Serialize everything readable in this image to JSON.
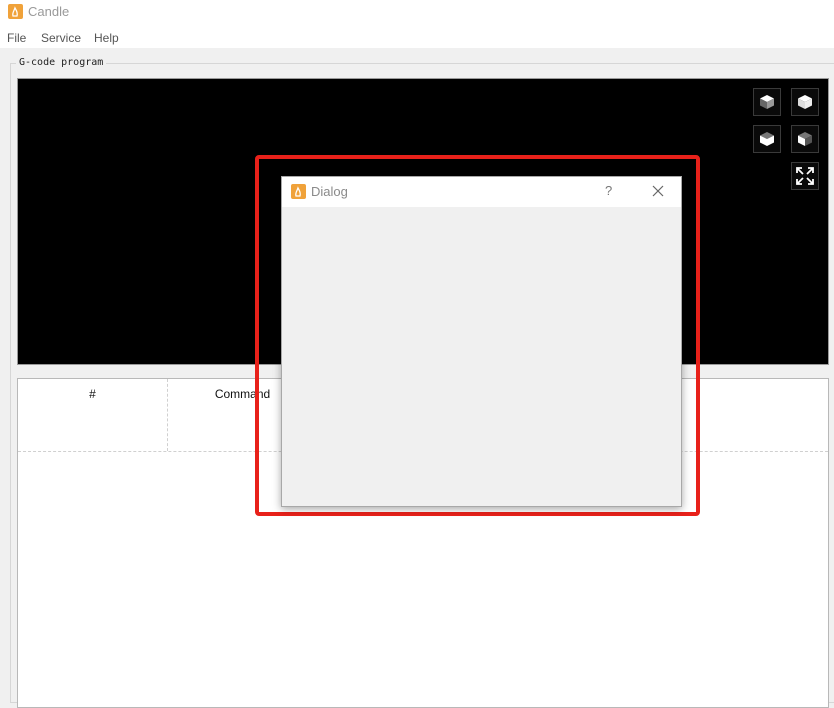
{
  "app": {
    "title": "Candle"
  },
  "menu": [
    "File",
    "Service",
    "Help"
  ],
  "group": {
    "title": "G-code program"
  },
  "viewer": {
    "buttons": [
      {
        "name": "view-isometric-button",
        "icon": "cube-iso-icon"
      },
      {
        "name": "view-top-button",
        "icon": "cube-top-icon"
      },
      {
        "name": "view-front-button",
        "icon": "cube-front-icon"
      },
      {
        "name": "view-left-button",
        "icon": "cube-left-icon"
      },
      {
        "name": "fit-view-button",
        "icon": "expand-icon"
      }
    ]
  },
  "table": {
    "columns": [
      "#",
      "Command"
    ]
  },
  "dialog": {
    "title": "Dialog",
    "help": "?",
    "close_icon": "close-icon"
  },
  "colors": {
    "highlight": "#e8211a",
    "app_icon": "#f0a23a",
    "viewer_bg": "#000000"
  }
}
